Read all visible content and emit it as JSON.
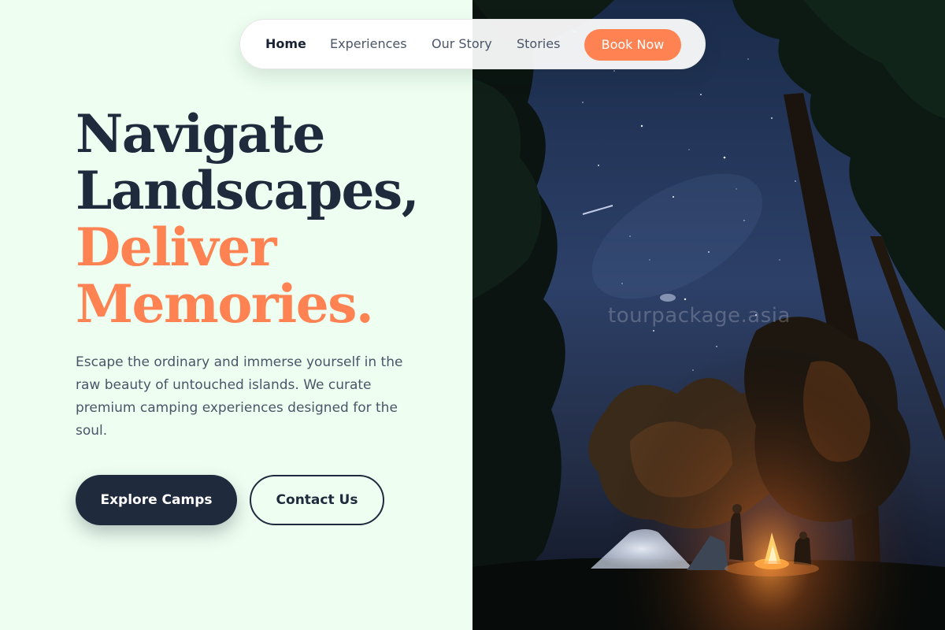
{
  "nav": {
    "items": [
      {
        "label": "Home",
        "active": true
      },
      {
        "label": "Experiences",
        "active": false
      },
      {
        "label": "Our Story",
        "active": false
      },
      {
        "label": "Stories",
        "active": false
      }
    ],
    "cta_label": "Book Now"
  },
  "hero": {
    "title_lines": [
      "Navigate",
      "Landscapes,"
    ],
    "accent_lines": [
      "Deliver",
      "Memories."
    ],
    "description": "Escape the ordinary and immerse yourself in the raw beauty of untouched islands. We curate premium camping experiences designed for the soul.",
    "primary_button": "Explore Camps",
    "secondary_button": "Contact Us"
  },
  "image": {
    "watermark": "tourpackage.asia",
    "icon": "night-campsite-photo"
  },
  "colors": {
    "navy": "#1f2a3d",
    "accent": "#ff8252",
    "background": "#eefff1",
    "body_text": "#4a5568"
  }
}
